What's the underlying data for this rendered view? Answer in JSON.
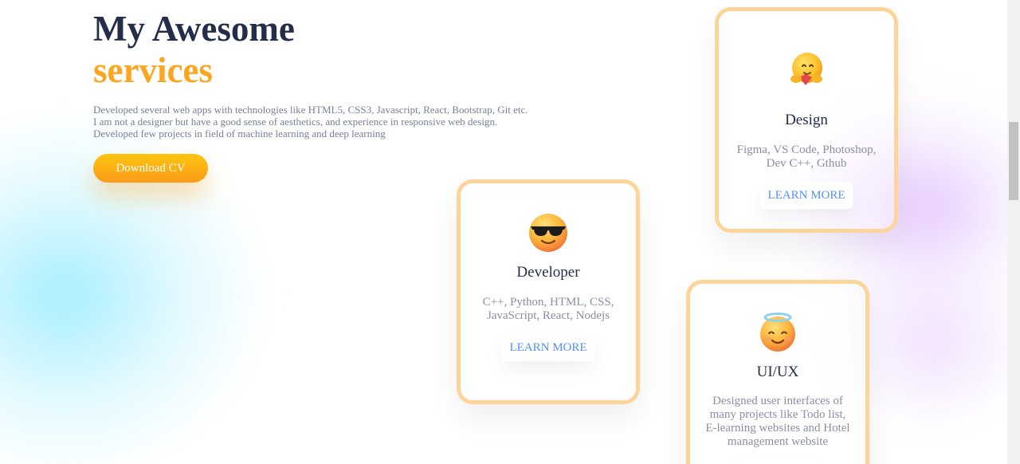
{
  "hero": {
    "title_line1": "My Awesome",
    "title_line2": "services",
    "description": [
      "Developed several web apps with technologies like HTML5, CSS3, Javascript, React, Bootstrap, Git etc.",
      "I am not a designer but have a good sense of aesthetics, and experience in responsive web design.",
      "Developed few projects in field of machine learning and deep learning"
    ],
    "cv_button": "Download CV"
  },
  "cards": {
    "design": {
      "icon": "hugging-face-emoji-icon",
      "title": "Design",
      "desc": [
        "Figma, VS Code, Photoshop,",
        "Dev C++, Gthub"
      ],
      "button": "LEARN MORE"
    },
    "developer": {
      "icon": "sunglasses-face-emoji-icon",
      "title": "Developer",
      "desc": [
        "C++, Python, HTML, CSS,",
        "JavaScript, React, Nodejs"
      ],
      "button": "LEARN MORE"
    },
    "uiux": {
      "icon": "halo-face-emoji-icon",
      "title": "UI/UX",
      "desc": [
        "Designed user interfaces of",
        "many projects like Todo list,",
        "E-learning websites and Hotel",
        "management website"
      ],
      "button": ""
    }
  },
  "colors": {
    "navy": "#242d49",
    "orange": "#fca61f",
    "gray_text": "#788097",
    "card_border": "#fdd59a",
    "link_blue": "#5290fd"
  }
}
